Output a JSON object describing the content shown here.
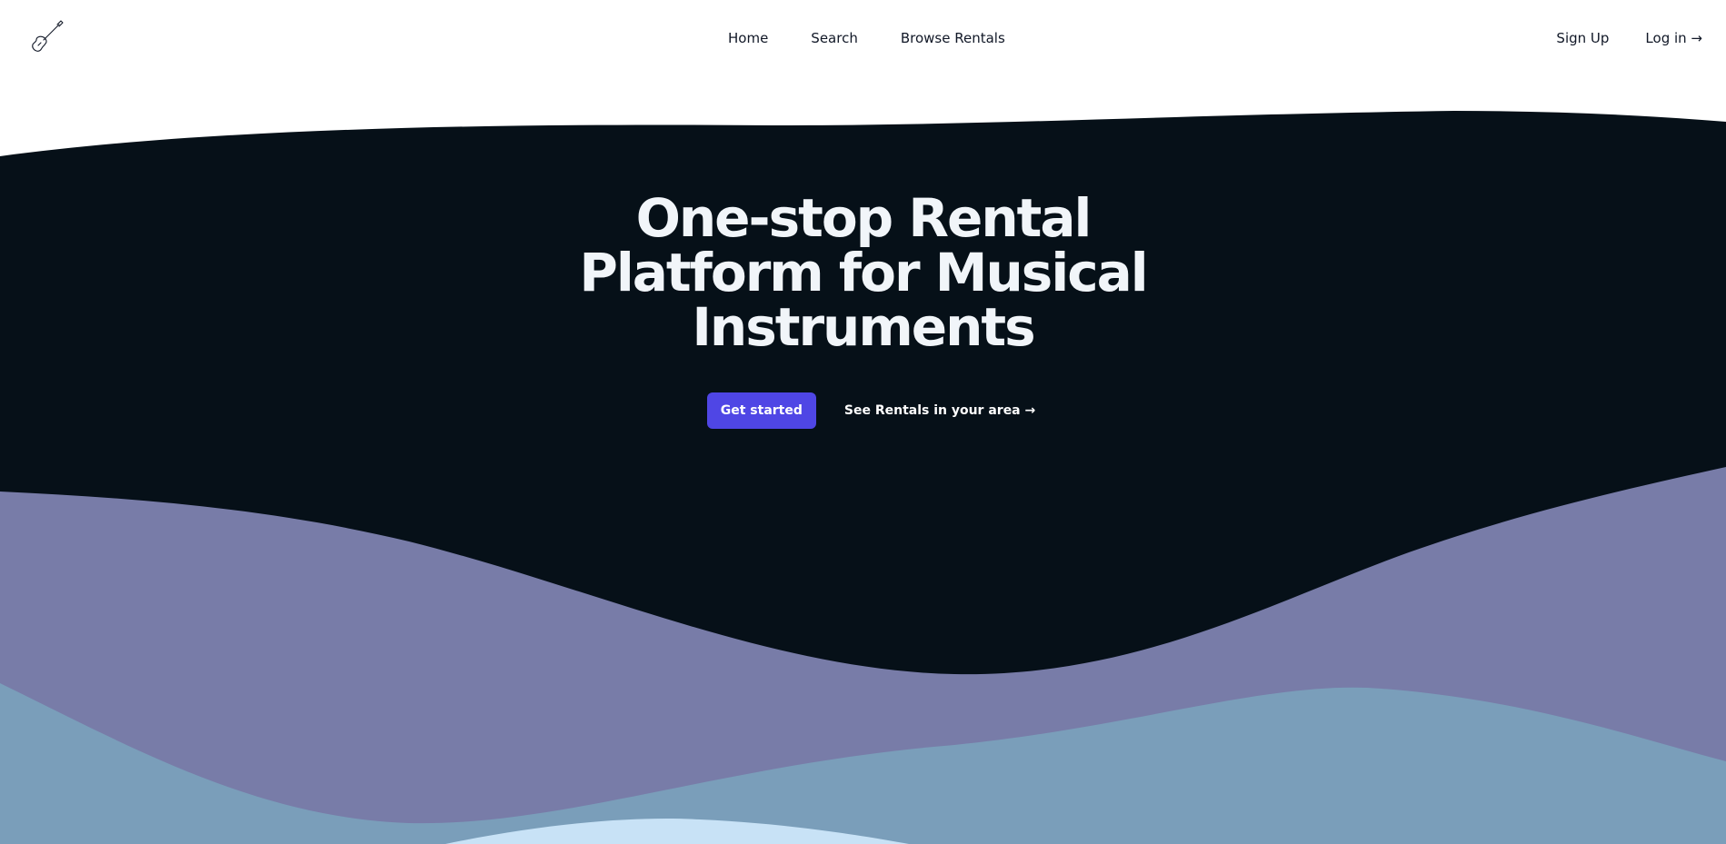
{
  "nav": {
    "logo_icon": "guitar-icon",
    "links": [
      "Home",
      "Search",
      "Browse Rentals"
    ],
    "signup_label": "Sign Up",
    "login_label": "Log in →"
  },
  "hero": {
    "title": "One-stop Rental Platform for Musical Instruments",
    "primary_cta": "Get started",
    "secondary_cta": "See Rentals in your area →"
  },
  "colors": {
    "hero_background": "#061018",
    "wave_purple": "#787ca8",
    "wave_steel_blue": "#7a9eba",
    "wave_light_blue": "#c8e2f6",
    "primary_button": "#4f46e5"
  }
}
